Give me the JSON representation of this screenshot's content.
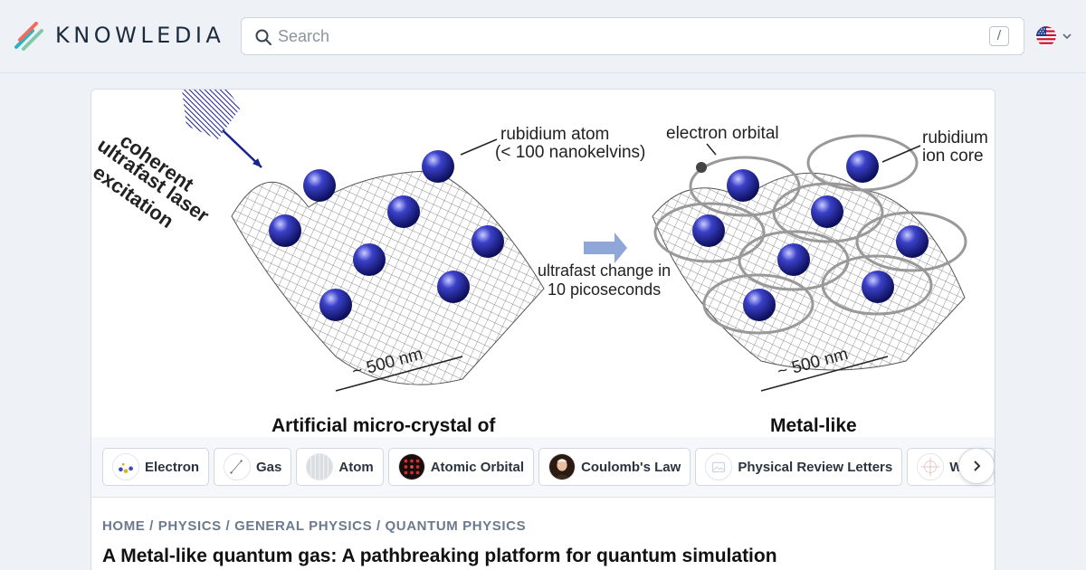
{
  "header": {
    "logo_text": "KNOWLEDIA",
    "search_placeholder": "Search",
    "search_value": "",
    "search_shortcut": "/",
    "language": "English (US)"
  },
  "figure": {
    "label_laser": [
      "coherent",
      "ultrafast laser",
      "excitation"
    ],
    "label_atom": [
      "rubidium atom",
      "(< 100 nanokelvins)"
    ],
    "label_orbital": "electron orbital",
    "label_core": [
      "rubidium",
      "ion core"
    ],
    "label_change": [
      "ultrafast change in",
      "10 picoseconds"
    ],
    "label_scale": "~ 500 nm",
    "caption_left": "Artificial micro-crystal of",
    "caption_right": "Metal-like",
    "colors": {
      "atom": "#2a2f9c",
      "mesh": "#555",
      "arrow": "#8ea6d8"
    }
  },
  "tags": [
    {
      "label": "Electron",
      "icon": "electron-thumb-icon"
    },
    {
      "label": "Gas",
      "icon": "gas-thumb-icon"
    },
    {
      "label": "Atom",
      "icon": "atom-thumb-icon"
    },
    {
      "label": "Atomic Orbital",
      "icon": "atomic-orbital-thumb-icon"
    },
    {
      "label": "Coulomb's Law",
      "icon": "coulomb-thumb-icon"
    },
    {
      "label": "Physical Review Letters",
      "icon": "journal-thumb-icon"
    },
    {
      "label": "Wave",
      "icon": "wave-thumb-icon"
    }
  ],
  "breadcrumb": [
    "HOME",
    "PHYSICS",
    "GENERAL PHYSICS",
    "QUANTUM PHYSICS"
  ],
  "breadcrumb_sep": " / ",
  "article": {
    "title": "A Metal-like quantum gas: A pathbreaking platform for quantum simulation"
  }
}
